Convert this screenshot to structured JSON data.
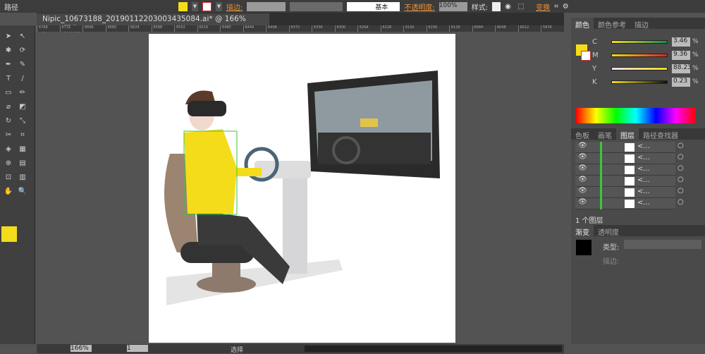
{
  "control_bar": {
    "object_type": "路径",
    "stroke_label": "描边:",
    "stroke_style": "基本",
    "opacity_label": "不透明度:",
    "opacity_value": "100%",
    "style_label": "样式:",
    "transform_label": "变换",
    "fill_color": "#f5dc1a"
  },
  "document": {
    "tab_title": "Nipic_10673188_20190112203003435084.ai* @ 166% (RGB/预览)",
    "close": "×"
  },
  "ruler": [
    "6768",
    "6732",
    "6696",
    "6660",
    "6624",
    "6588",
    "6552",
    "6516",
    "6480",
    "6444",
    "6408",
    "6372",
    "6336",
    "6300",
    "6264",
    "6228",
    "6192",
    "6156",
    "6120",
    "6084",
    "6048",
    "6012",
    "5976"
  ],
  "color_panel": {
    "tabs": [
      "颜色",
      "颜色参考",
      "描边"
    ],
    "channels": [
      {
        "label": "C",
        "value": "3.46",
        "level": 3.46
      },
      {
        "label": "M",
        "value": "9.36",
        "level": 9.36
      },
      {
        "label": "Y",
        "value": "88.23",
        "level": 88.23
      },
      {
        "label": "K",
        "value": "0.23",
        "level": 0.23
      }
    ],
    "unit": "%"
  },
  "layers_panel": {
    "tabs": [
      "色板",
      "画笔",
      "图层",
      "路径查找器"
    ],
    "rows": [
      {
        "name": "<..."
      },
      {
        "name": "<..."
      },
      {
        "name": "<..."
      },
      {
        "name": "<..."
      },
      {
        "name": "<..."
      },
      {
        "name": "<..."
      }
    ],
    "count_label": "1 个图层"
  },
  "gradient_panel": {
    "tabs": [
      "渐变",
      "透明度"
    ],
    "type_label": "类型:",
    "stroke_label": "描边:"
  },
  "status_bar": {
    "zoom": "166%",
    "page": "1",
    "tool": "选择"
  }
}
